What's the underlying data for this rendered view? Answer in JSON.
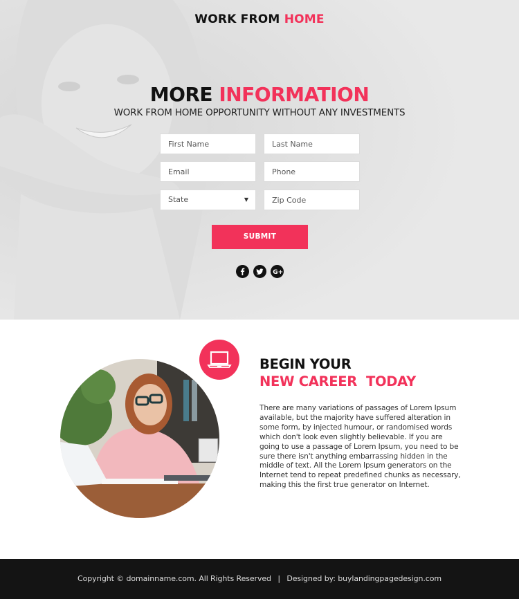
{
  "brand": {
    "part1": "WORK FROM ",
    "part2": "HOME",
    "accent_color": "#f2325a"
  },
  "hero": {
    "headline_part1": "MORE ",
    "headline_part2": "INFORMATION",
    "subheadline": "WORK FROM HOME OPPORTUNITY WITHOUT ANY INVESTMENTS"
  },
  "form": {
    "first_name": {
      "placeholder": "First Name",
      "value": ""
    },
    "last_name": {
      "placeholder": "Last Name",
      "value": ""
    },
    "email": {
      "placeholder": "Email",
      "value": ""
    },
    "phone": {
      "placeholder": "Phone",
      "value": ""
    },
    "state": {
      "selected": "State",
      "arrow": "▼"
    },
    "zip": {
      "placeholder": "Zip Code",
      "value": ""
    },
    "submit_label": "SUBMIT"
  },
  "social": [
    {
      "name": "facebook-icon"
    },
    {
      "name": "twitter-icon"
    },
    {
      "name": "google-plus-icon"
    }
  ],
  "career": {
    "heading_line1": "BEGIN YOUR",
    "heading_line2": "NEW CAREER  TODAY",
    "badge_icon": "laptop-icon",
    "paragraph": "There are many variations of passages of Lorem Ipsum available, but the majority have suffered alteration in some form, by injected humour, or randomised words which don't look even slightly believable. If you are going to use a passage of Lorem Ipsum, you need to be sure there isn't anything embarrassing hidden in the middle of text. All the Lorem Ipsum generators on the Internet tend to repeat predefined chunks as necessary, making this the first true generator on Internet."
  },
  "footer": {
    "copyright": "Copyright © domainname.com. All Rights Reserved",
    "separator": "|",
    "designed_by": "Designed by: buylandingpagedesign.com"
  }
}
